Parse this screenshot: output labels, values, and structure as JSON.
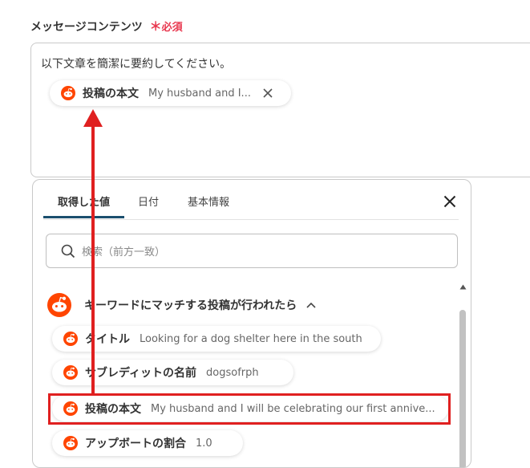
{
  "field": {
    "label": "メッセージコンテンツ",
    "required_star": "＊",
    "required_text": "必須",
    "text": "以下文章を簡潔に要約してください。"
  },
  "inserted_chip": {
    "title": "投稿の本文",
    "value": "My husband and I..."
  },
  "panel": {
    "tabs": [
      {
        "label": "取得した値",
        "active": true
      },
      {
        "label": "日付",
        "active": false
      },
      {
        "label": "基本情報",
        "active": false
      }
    ],
    "search_placeholder": "検索（前方一致）",
    "group": {
      "title": "キーワードにマッチする投稿が行われたら"
    },
    "items": [
      {
        "title": "タイトル",
        "value": "Looking for a dog shelter here in the south"
      },
      {
        "title": "サブレディットの名前",
        "value": "dogsofrph"
      },
      {
        "title": "投稿の本文",
        "value": "My husband and I will be celebrating our first annive..."
      },
      {
        "title": "アップボートの割合",
        "value": "1.0"
      }
    ]
  },
  "colors": {
    "reddit_orange": "#ff4500",
    "highlight_red": "#e02020",
    "tab_underline": "#1b4f6e",
    "required": "#e8384f"
  }
}
